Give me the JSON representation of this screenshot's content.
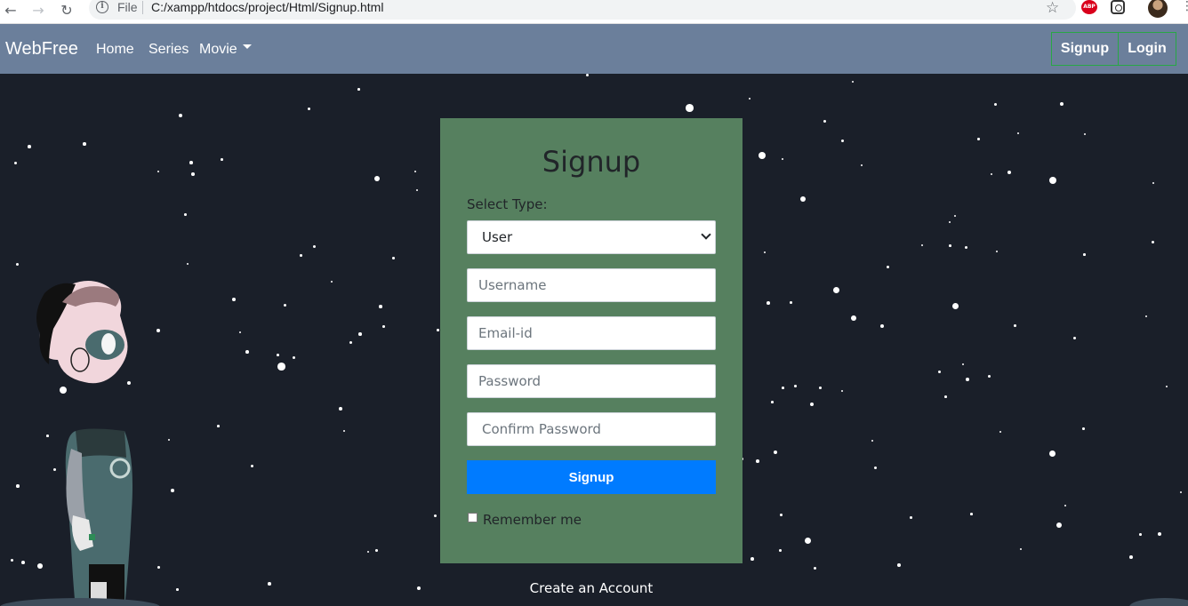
{
  "browser": {
    "scheme": "File",
    "url": "C:/xampp/htdocs/project/Html/Signup.html",
    "ext_abp": "ABP"
  },
  "navbar": {
    "brand": "WebFree",
    "links": [
      "Home",
      "Series",
      "Movie"
    ],
    "signup": "Signup",
    "login": "Login"
  },
  "form": {
    "title": "Signup",
    "select_label": "Select Type:",
    "select_value": "User",
    "username_placeholder": "Username",
    "email_placeholder": "Email-id",
    "password_placeholder": "Password",
    "confirm_placeholder": "Confirm Password",
    "submit": "Signup",
    "remember": "Remember me"
  },
  "footer_link": "Create an Account",
  "colors": {
    "navbar": "#6b7f9b",
    "card": "#56805f",
    "primary": "#007bff",
    "outline": "#28a745",
    "scene": "#1a1f29"
  },
  "icons": [
    "back-arrow-icon",
    "forward-arrow-icon",
    "reload-icon",
    "info-icon",
    "star-icon",
    "abp-extension-icon",
    "extension-icon",
    "profile-avatar",
    "menu-icon",
    "caret-down-icon",
    "chevron-down-icon"
  ]
}
